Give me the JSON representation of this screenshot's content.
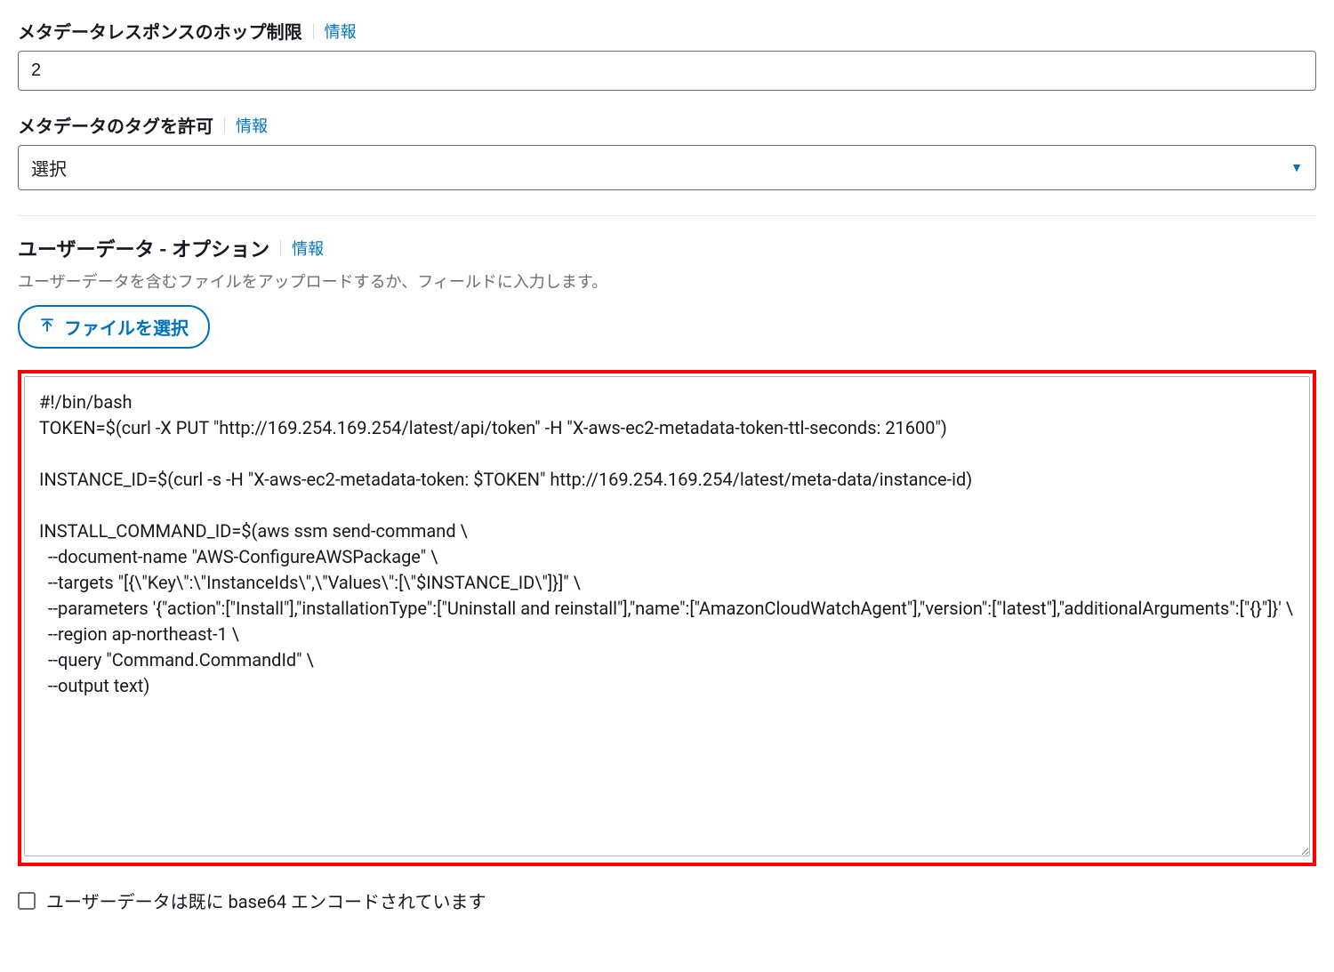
{
  "hop_limit": {
    "label": "メタデータレスポンスのホップ制限",
    "info": "情報",
    "value": "2"
  },
  "tag_allow": {
    "label": "メタデータのタグを許可",
    "info": "情報",
    "selected": "選択"
  },
  "user_data": {
    "title": "ユーザーデータ - オプション",
    "info": "情報",
    "description": "ユーザーデータを含むファイルをアップロードするか、フィールドに入力します。",
    "file_button": "ファイルを選択",
    "content": "#!/bin/bash\nTOKEN=$(curl -X PUT \"http://169.254.169.254/latest/api/token\" -H \"X-aws-ec2-metadata-token-ttl-seconds: 21600\")\n\nINSTANCE_ID=$(curl -s -H \"X-aws-ec2-metadata-token: $TOKEN\" http://169.254.169.254/latest/meta-data/instance-id)\n\nINSTALL_COMMAND_ID=$(aws ssm send-command \\\n  --document-name \"AWS-ConfigureAWSPackage\" \\\n  --targets \"[{\\\"Key\\\":\\\"InstanceIds\\\",\\\"Values\\\":[\\\"$INSTANCE_ID\\\"]}]\" \\\n  --parameters '{\"action\":[\"Install\"],\"installationType\":[\"Uninstall and reinstall\"],\"name\":[\"AmazonCloudWatchAgent\"],\"version\":[\"latest\"],\"additionalArguments\":[\"{}\"]}' \\\n  --region ap-northeast-1 \\\n  --query \"Command.CommandId\" \\\n  --output text)",
    "base64_checkbox": "ユーザーデータは既に base64 エンコードされています"
  }
}
